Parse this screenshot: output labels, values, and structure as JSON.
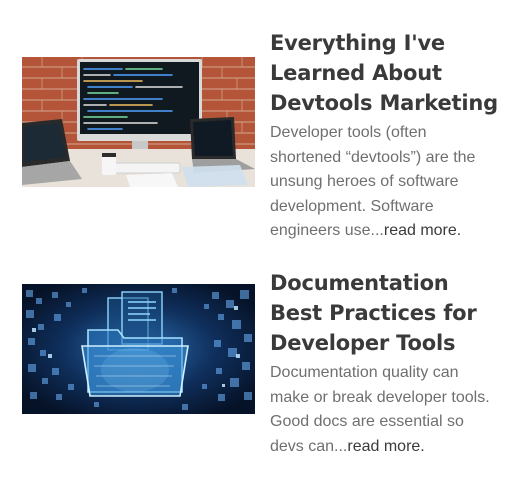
{
  "posts": [
    {
      "title": "Everything I've Learned About Devtools Marketing",
      "excerpt": "Developer tools (often shortened “devtools”) are the unsung heroes of software development. Software engineers use...",
      "read_more": "read more.",
      "thumbnail_icon": "code-on-monitor-photo"
    },
    {
      "title": "Documentation Best Practices for Developer Tools",
      "excerpt": "Documentation quality can make or break developer tools. Good docs are essential so devs can...",
      "read_more": "read more.",
      "thumbnail_icon": "digital-folder-documents-photo"
    }
  ],
  "colors": {
    "title": "#3a3a3a",
    "excerpt": "#6f6f6f",
    "brick": "#b4553a",
    "folder_glow": "#8fd6ff"
  }
}
